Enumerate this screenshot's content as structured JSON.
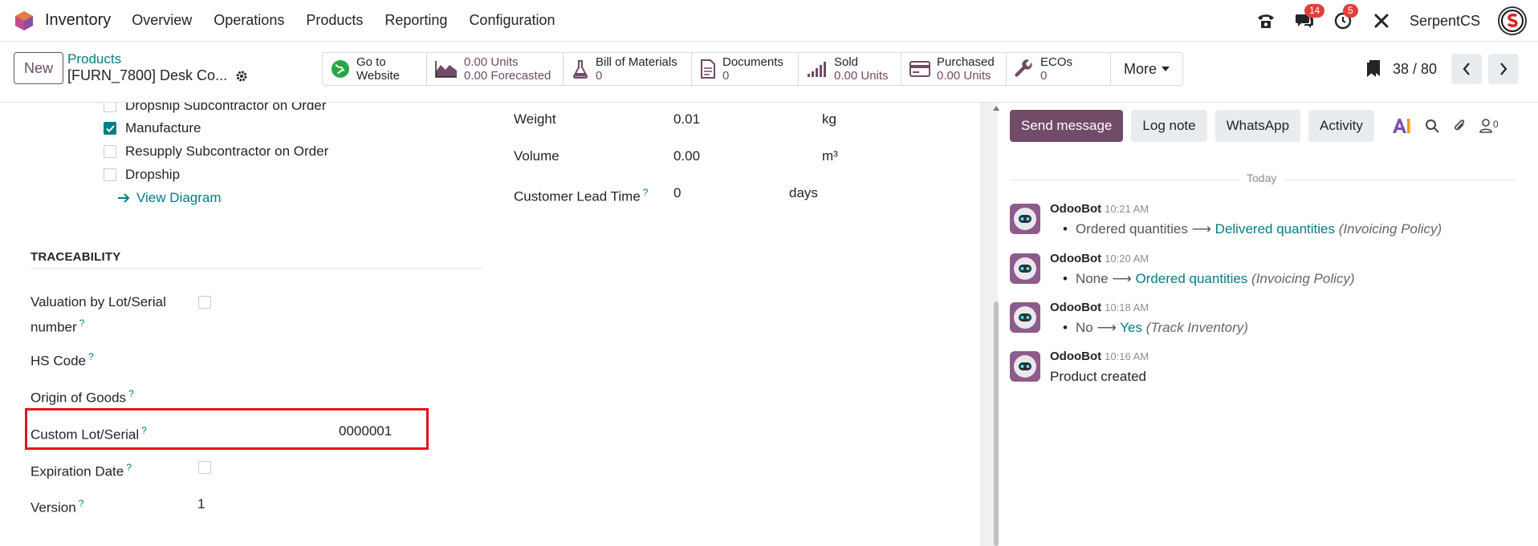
{
  "navbar": {
    "app_name": "Inventory",
    "menu": [
      "Overview",
      "Operations",
      "Products",
      "Reporting",
      "Configuration"
    ],
    "messages_count": "14",
    "activities_count": "5",
    "company": "SerpentCS"
  },
  "control": {
    "new_label": "New",
    "breadcrumb": "Products",
    "record_name": "[FURN_7800] Desk Co...",
    "smart_buttons": {
      "website": {
        "label1": "Go to",
        "label2": "Website"
      },
      "units": {
        "label": "0.00 Units",
        "value": "0.00 Forecasted"
      },
      "bom": {
        "label": "Bill of Materials",
        "value": "0"
      },
      "documents": {
        "label": "Documents",
        "value": "0"
      },
      "sold": {
        "label": "Sold",
        "value": "0.00 Units"
      },
      "purchased": {
        "label": "Purchased",
        "value": "0.00 Units"
      },
      "ecos": {
        "label": "ECOs",
        "value": "0"
      },
      "more": "More"
    },
    "pager": "38 / 80"
  },
  "form": {
    "routes": [
      {
        "label": "Dropship Subcontractor on Order",
        "checked": false
      },
      {
        "label": "Manufacture",
        "checked": true
      },
      {
        "label": "Resupply Subcontractor on Order",
        "checked": false
      },
      {
        "label": "Dropship",
        "checked": false
      }
    ],
    "view_diagram": "View Diagram",
    "weight_label": "Weight",
    "weight_value": "0.01",
    "weight_unit": "kg",
    "volume_label": "Volume",
    "volume_value": "0.00",
    "volume_unit": "m³",
    "lead_label": "Customer Lead Time",
    "lead_value": "0",
    "lead_unit": "days",
    "traceability_title": "TRACEABILITY",
    "valuation_label_1": "Valuation by Lot/Serial",
    "valuation_label_2": "number",
    "hs_code_label": "HS Code",
    "origin_label": "Origin of Goods",
    "custom_lot_label": "Custom Lot/Serial",
    "custom_lot_value": "0000001",
    "expiration_label": "Expiration Date",
    "version_label": "Version",
    "version_value": "1",
    "help_mark": "?"
  },
  "chatter": {
    "send_message": "Send message",
    "log_note": "Log note",
    "whatsapp": "WhatsApp",
    "activity": "Activity",
    "followers_count": "0",
    "today": "Today",
    "messages": [
      {
        "author": "OdooBot",
        "time": "10:21 AM",
        "old": "Ordered quantities",
        "new": "Delivered quantities",
        "field": "(Invoicing Policy)"
      },
      {
        "author": "OdooBot",
        "time": "10:20 AM",
        "old": "None",
        "new": "Ordered quantities",
        "field": "(Invoicing Policy)"
      },
      {
        "author": "OdooBot",
        "time": "10:18 AM",
        "old": "No",
        "new": "Yes",
        "field": "(Track Inventory)"
      },
      {
        "author": "OdooBot",
        "time": "10:16 AM",
        "text": "Product created"
      }
    ]
  }
}
